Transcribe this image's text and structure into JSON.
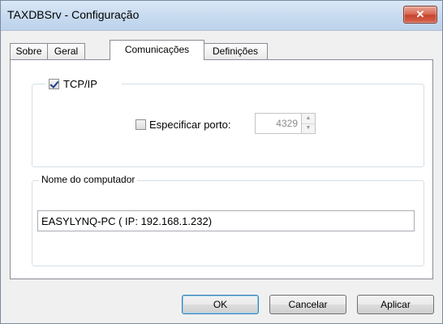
{
  "window": {
    "title": "TAXDBSrv - Configuração",
    "close_label": "✕"
  },
  "tabs": [
    {
      "label": "Sobre",
      "active": false
    },
    {
      "label": "Geral",
      "active": false
    },
    {
      "label": "Comunicações",
      "active": true
    },
    {
      "label": "Definições",
      "active": false
    }
  ],
  "tcpip": {
    "label": "TCP/IP",
    "checked": true,
    "specify_port_label": "Especificar porto:",
    "specify_port_checked": false,
    "port_value": "4329"
  },
  "computer": {
    "group_label": "Nome do computador",
    "value": "EASYLYNQ-PC  ( IP: 192.168.1.232)"
  },
  "buttons": {
    "ok": "OK",
    "cancel": "Cancelar",
    "apply": "Aplicar"
  }
}
